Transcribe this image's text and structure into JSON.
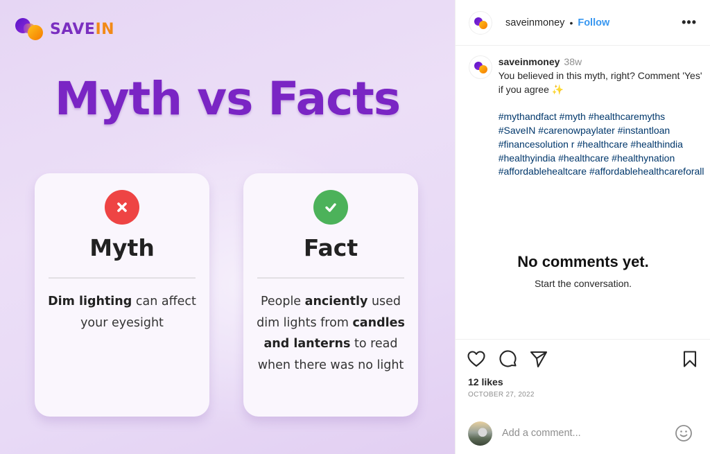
{
  "post_image": {
    "brand": {
      "part1": "SAVE",
      "part2": "IN"
    },
    "title": "Myth vs Facts",
    "cards": [
      {
        "title": "Myth",
        "icon": "x-icon",
        "body_bold_1": "Dim lighting",
        "body_1": " can affect your eyesight"
      },
      {
        "title": "Fact",
        "icon": "check-icon",
        "body_1": "People ",
        "body_bold_1": "anciently",
        "body_2": " used dim lights from ",
        "body_bold_2": "candles and lanterns",
        "body_3": " to read when there was no light"
      }
    ],
    "colors": {
      "title": "#7a25c4",
      "myth_badge": "#ee4444",
      "fact_badge": "#4cb25a",
      "brand_purple": "#7a2fc0",
      "brand_orange": "#f28a17"
    }
  },
  "header": {
    "username": "saveinmoney",
    "separator": "•",
    "follow_label": "Follow",
    "more_icon": "more-horizontal-icon"
  },
  "caption": {
    "username": "saveinmoney",
    "time": "38w",
    "text": "You believed in this myth, right? Comment 'Yes' if you agree",
    "emoji": "✨",
    "hashtags": [
      "#mythandfact",
      "#myth",
      "#healthcaremyths",
      "#SaveIN",
      "#carenowpaylater",
      "#instantloan",
      "#financesolution",
      "r",
      "#healthcare",
      "#healthindia",
      "#healthyindia",
      "#healthcare",
      "#healthynation",
      "#affordablehealtcare",
      "#affordablehealthcareforall"
    ]
  },
  "comments": {
    "empty_title": "No comments yet.",
    "empty_subtitle": "Start the conversation."
  },
  "actions": {
    "like_icon": "heart-icon",
    "comment_icon": "comment-icon",
    "share_icon": "send-icon",
    "save_icon": "bookmark-icon",
    "likes": "12 likes",
    "date": "OCTOBER 27, 2022"
  },
  "comment_box": {
    "placeholder": "Add a comment...",
    "value": "",
    "emoji_icon": "smiley-icon"
  },
  "colors": {
    "follow": "#3897f0",
    "hashtag": "#00376b",
    "muted": "#8e8e8e"
  }
}
